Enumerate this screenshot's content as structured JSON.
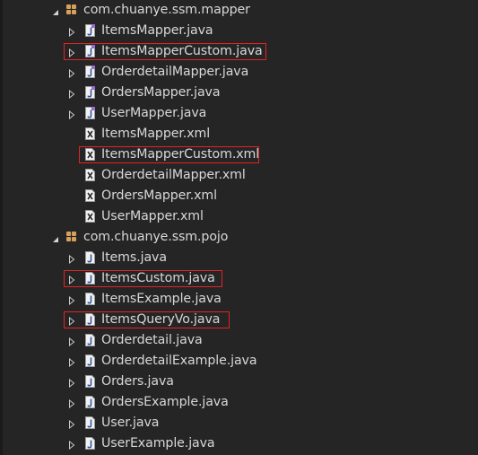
{
  "packages": [
    {
      "label": "com.chuanye.ssm.mapper",
      "files": [
        {
          "label": "ItemsMapper.java",
          "icon": "java-interface-file-icon",
          "expandable": true,
          "highlighted": false
        },
        {
          "label": "ItemsMapperCustom.java",
          "icon": "java-interface-file-icon",
          "expandable": true,
          "highlighted": true
        },
        {
          "label": "OrderdetailMapper.java",
          "icon": "java-interface-file-icon",
          "expandable": true,
          "highlighted": false
        },
        {
          "label": "OrdersMapper.java",
          "icon": "java-interface-file-icon",
          "expandable": true,
          "highlighted": false
        },
        {
          "label": "UserMapper.java",
          "icon": "java-interface-file-icon",
          "expandable": true,
          "highlighted": false
        },
        {
          "label": "ItemsMapper.xml",
          "icon": "xml-file-icon",
          "expandable": false,
          "highlighted": false
        },
        {
          "label": "ItemsMapperCustom.xml",
          "icon": "xml-file-icon",
          "expandable": false,
          "highlighted": true
        },
        {
          "label": "OrderdetailMapper.xml",
          "icon": "xml-file-icon",
          "expandable": false,
          "highlighted": false
        },
        {
          "label": "OrdersMapper.xml",
          "icon": "xml-file-icon",
          "expandable": false,
          "highlighted": false
        },
        {
          "label": "UserMapper.xml",
          "icon": "xml-file-icon",
          "expandable": false,
          "highlighted": false
        }
      ]
    },
    {
      "label": "com.chuanye.ssm.pojo",
      "files": [
        {
          "label": "Items.java",
          "icon": "java-file-icon",
          "expandable": true,
          "highlighted": false
        },
        {
          "label": "ItemsCustom.java",
          "icon": "java-file-icon",
          "expandable": true,
          "highlighted": true
        },
        {
          "label": "ItemsExample.java",
          "icon": "java-file-icon",
          "expandable": true,
          "highlighted": false
        },
        {
          "label": "ItemsQueryVo.java",
          "icon": "java-file-icon",
          "expandable": true,
          "highlighted": true
        },
        {
          "label": "Orderdetail.java",
          "icon": "java-file-icon",
          "expandable": true,
          "highlighted": false
        },
        {
          "label": "OrderdetailExample.java",
          "icon": "java-file-icon",
          "expandable": true,
          "highlighted": false
        },
        {
          "label": "Orders.java",
          "icon": "java-file-icon",
          "expandable": true,
          "highlighted": false
        },
        {
          "label": "OrdersExample.java",
          "icon": "java-file-icon",
          "expandable": true,
          "highlighted": false
        },
        {
          "label": "User.java",
          "icon": "java-file-icon",
          "expandable": true,
          "highlighted": false
        },
        {
          "label": "UserExample.java",
          "icon": "java-file-icon",
          "expandable": true,
          "highlighted": false
        }
      ]
    }
  ],
  "colors": {
    "background": "#252526",
    "text": "#d8d8d8",
    "package_icon": "#d9a05a",
    "highlight_border": "#e02424",
    "java_icon_badge": "#4a7fd4",
    "interface_icon_badge": "#9b6bd1"
  }
}
